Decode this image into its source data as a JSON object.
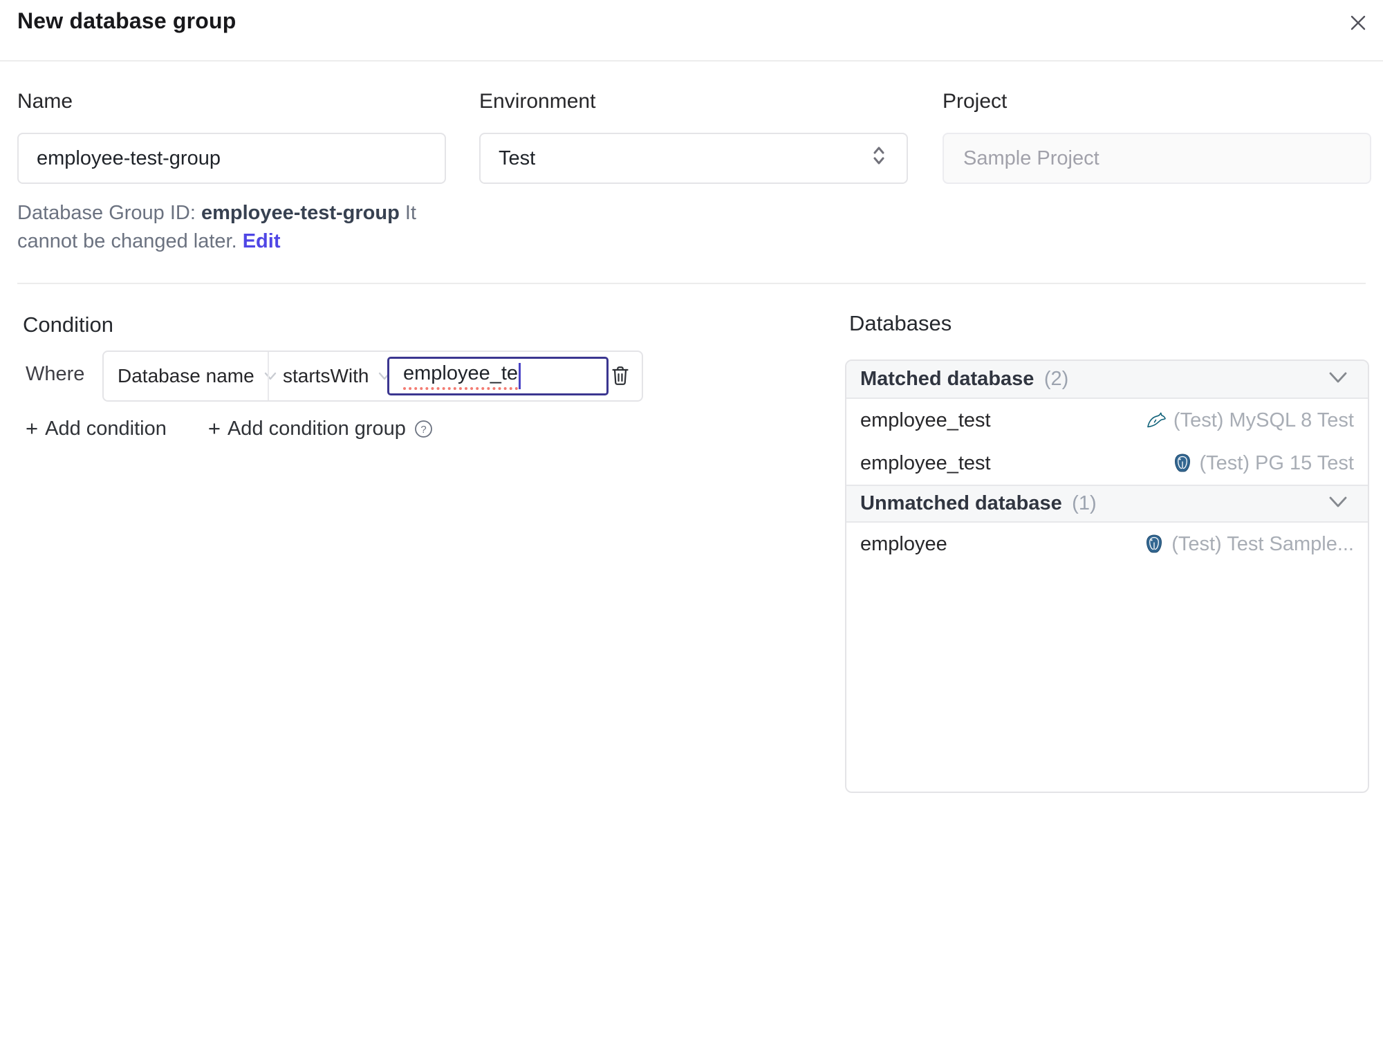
{
  "dialog": {
    "title": "New database group"
  },
  "form": {
    "name": {
      "label": "Name",
      "value": "employee-test-group"
    },
    "environment": {
      "label": "Environment",
      "value": "Test"
    },
    "project": {
      "label": "Project",
      "value": "Sample Project"
    },
    "id_hint": {
      "prefix": "Database Group ID: ",
      "id": "employee-test-group",
      "suffix": " It cannot be changed later. ",
      "edit_label": "Edit"
    }
  },
  "condition": {
    "heading": "Condition",
    "where_label": "Where",
    "plus": "+",
    "field": "Database name",
    "operator": "startsWith",
    "value": "employee_te",
    "add_condition_label": "Add condition",
    "add_condition_group_label": "Add condition group"
  },
  "databases": {
    "heading": "Databases",
    "sections": [
      {
        "title": "Matched database",
        "count": "(2)",
        "rows": [
          {
            "name": "employee_test",
            "instance": "(Test) MySQL 8 Test",
            "engine": "mysql"
          },
          {
            "name": "employee_test",
            "instance": "(Test) PG 15 Test",
            "engine": "postgres"
          }
        ]
      },
      {
        "title": "Unmatched database",
        "count": "(1)",
        "rows": [
          {
            "name": "employee",
            "instance": "(Test) Test Sample...",
            "engine": "postgres"
          }
        ]
      }
    ]
  },
  "colors": {
    "accent": "#4f46e5",
    "focus_border": "#3b3690",
    "spellcheck_red": "#f37b72",
    "mysql_teal": "#0f6179",
    "postgres_blue": "#336791",
    "section_header_bg": "#f6f7f8",
    "border_gray": "#e4e4e7"
  }
}
